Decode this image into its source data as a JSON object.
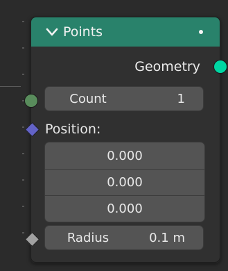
{
  "node": {
    "title": "Points",
    "output_label": "Geometry",
    "count": {
      "label": "Count",
      "value": "1"
    },
    "position": {
      "label": "Position:",
      "values": [
        "0.000",
        "0.000",
        "0.000"
      ]
    },
    "radius": {
      "label": "Radius",
      "value": "0.1 m"
    }
  },
  "colors": {
    "header": "#29826b",
    "geometry_socket": "#00d6a3",
    "integer_socket": "#598c5c",
    "vector_socket": "#6363c7",
    "float_socket": "#a1a1a1"
  },
  "icons": {
    "collapse": "chevron-down-icon"
  }
}
